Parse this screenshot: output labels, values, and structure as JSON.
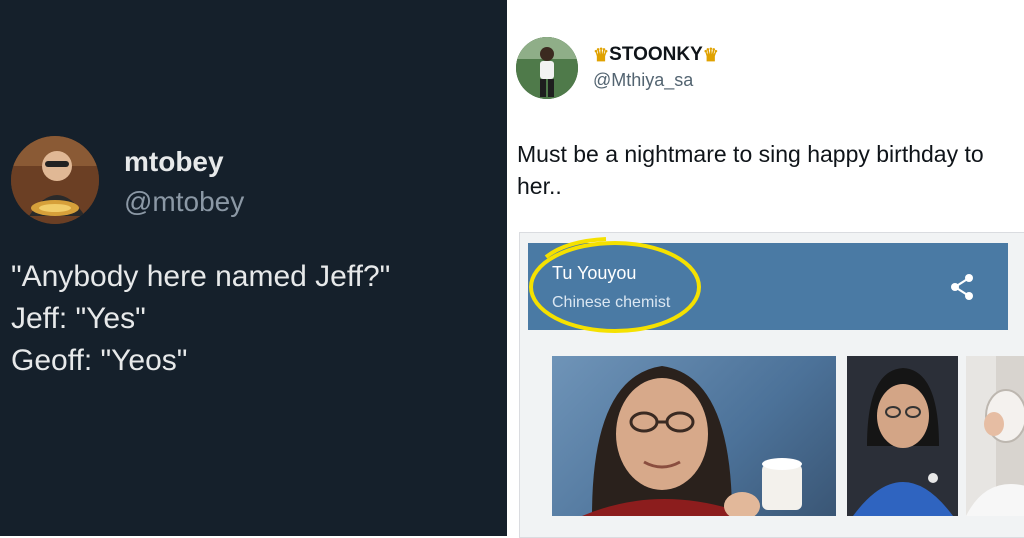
{
  "left_tweet": {
    "name": "mtobey",
    "handle": "@mtobey",
    "lines": [
      "\"Anybody here named Jeff?\"",
      "Jeff: \"Yes\"",
      "Geoff: \"Yeos\""
    ]
  },
  "right_tweet": {
    "name": "STOONKY",
    "handle": "@Mthiya_sa",
    "text": "Must be a nightmare to sing happy birthday to her..",
    "card": {
      "title": "Tu Youyou",
      "subtitle": "Chinese chemist"
    }
  },
  "colors": {
    "dark_bg": "#15202b",
    "card_header": "#4a7aa4",
    "highlight": "#f5e100"
  }
}
